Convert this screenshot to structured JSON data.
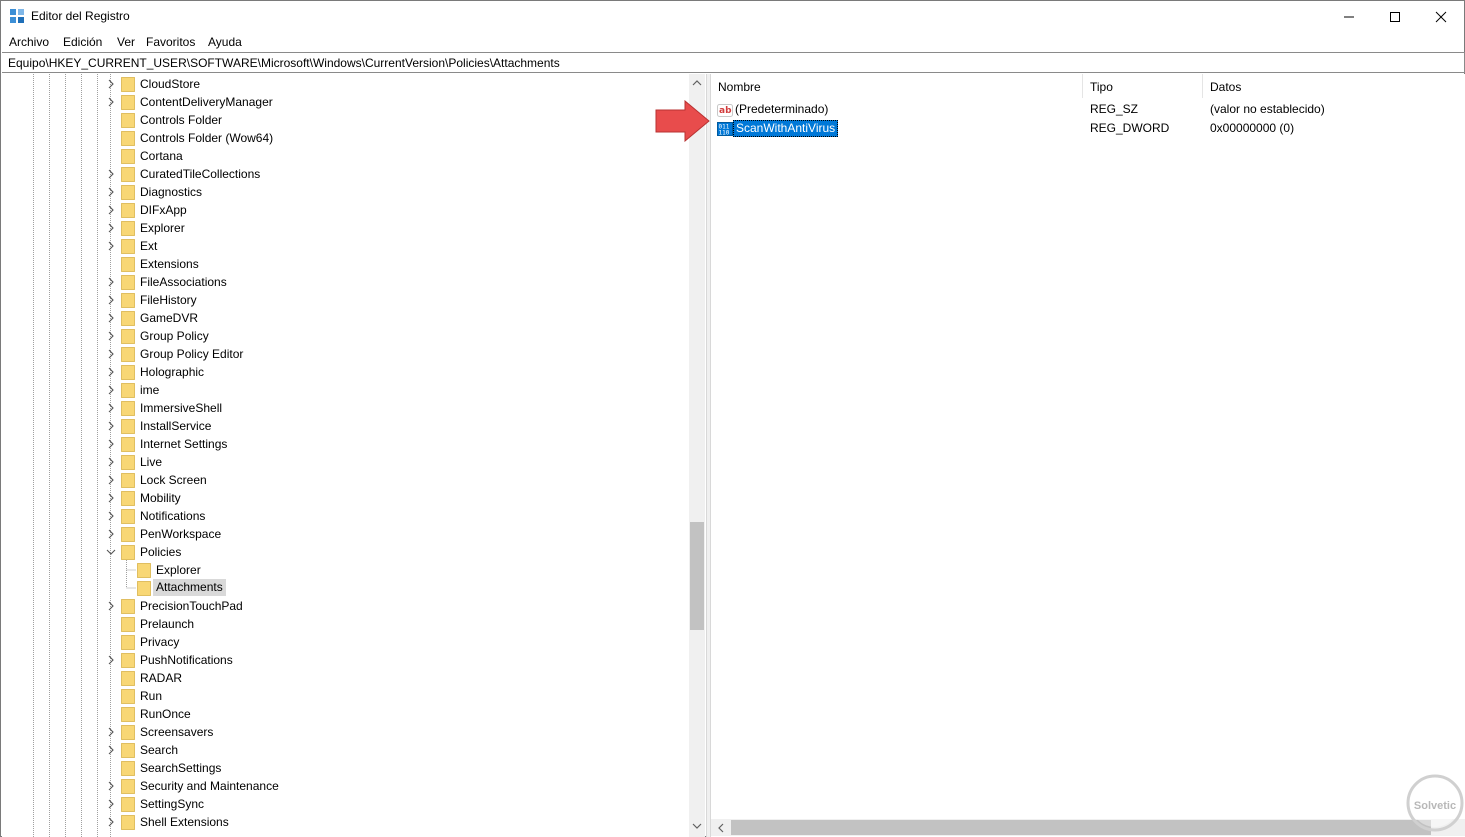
{
  "window": {
    "title": "Editor del Registro"
  },
  "menu": [
    "Archivo",
    "Edición",
    "Ver",
    "Favoritos",
    "Ayuda"
  ],
  "address": "Equipo\\HKEY_CURRENT_USER\\SOFTWARE\\Microsoft\\Windows\\CurrentVersion\\Policies\\Attachments",
  "tree": [
    {
      "label": "CloudStore",
      "expander": "collapsed",
      "level": 1
    },
    {
      "label": "ContentDeliveryManager",
      "expander": "collapsed",
      "level": 1
    },
    {
      "label": "Controls Folder",
      "expander": "none",
      "level": 1
    },
    {
      "label": "Controls Folder (Wow64)",
      "expander": "none",
      "level": 1
    },
    {
      "label": "Cortana",
      "expander": "none",
      "level": 1
    },
    {
      "label": "CuratedTileCollections",
      "expander": "collapsed",
      "level": 1
    },
    {
      "label": "Diagnostics",
      "expander": "collapsed",
      "level": 1
    },
    {
      "label": "DIFxApp",
      "expander": "collapsed",
      "level": 1
    },
    {
      "label": "Explorer",
      "expander": "collapsed",
      "level": 1
    },
    {
      "label": "Ext",
      "expander": "collapsed",
      "level": 1
    },
    {
      "label": "Extensions",
      "expander": "none",
      "level": 1
    },
    {
      "label": "FileAssociations",
      "expander": "collapsed",
      "level": 1
    },
    {
      "label": "FileHistory",
      "expander": "collapsed",
      "level": 1
    },
    {
      "label": "GameDVR",
      "expander": "collapsed",
      "level": 1
    },
    {
      "label": "Group Policy",
      "expander": "collapsed",
      "level": 1
    },
    {
      "label": "Group Policy Editor",
      "expander": "collapsed",
      "level": 1
    },
    {
      "label": "Holographic",
      "expander": "collapsed",
      "level": 1
    },
    {
      "label": "ime",
      "expander": "collapsed",
      "level": 1
    },
    {
      "label": "ImmersiveShell",
      "expander": "collapsed",
      "level": 1
    },
    {
      "label": "InstallService",
      "expander": "collapsed",
      "level": 1
    },
    {
      "label": "Internet Settings",
      "expander": "collapsed",
      "level": 1
    },
    {
      "label": "Live",
      "expander": "collapsed",
      "level": 1
    },
    {
      "label": "Lock Screen",
      "expander": "collapsed",
      "level": 1
    },
    {
      "label": "Mobility",
      "expander": "collapsed",
      "level": 1
    },
    {
      "label": "Notifications",
      "expander": "collapsed",
      "level": 1
    },
    {
      "label": "PenWorkspace",
      "expander": "collapsed",
      "level": 1
    },
    {
      "label": "Policies",
      "expander": "expanded",
      "level": 1
    },
    {
      "label": "Explorer",
      "expander": "none",
      "level": 2
    },
    {
      "label": "Attachments",
      "expander": "none",
      "level": 2,
      "selected": true
    },
    {
      "label": "PrecisionTouchPad",
      "expander": "collapsed",
      "level": 1
    },
    {
      "label": "Prelaunch",
      "expander": "none",
      "level": 1
    },
    {
      "label": "Privacy",
      "expander": "none",
      "level": 1
    },
    {
      "label": "PushNotifications",
      "expander": "collapsed",
      "level": 1
    },
    {
      "label": "RADAR",
      "expander": "none",
      "level": 1
    },
    {
      "label": "Run",
      "expander": "none",
      "level": 1
    },
    {
      "label": "RunOnce",
      "expander": "none",
      "level": 1
    },
    {
      "label": "Screensavers",
      "expander": "collapsed",
      "level": 1
    },
    {
      "label": "Search",
      "expander": "collapsed",
      "level": 1
    },
    {
      "label": "SearchSettings",
      "expander": "none",
      "level": 1
    },
    {
      "label": "Security and Maintenance",
      "expander": "collapsed",
      "level": 1
    },
    {
      "label": "SettingSync",
      "expander": "collapsed",
      "level": 1
    },
    {
      "label": "Shell Extensions",
      "expander": "collapsed",
      "level": 1
    }
  ],
  "list": {
    "columns": [
      "Nombre",
      "Tipo",
      "Datos"
    ],
    "rows": [
      {
        "name": "(Predeterminado)",
        "type": "REG_SZ",
        "data": "(valor no establecido)",
        "icon": "string-value-icon",
        "selected": false
      },
      {
        "name": "ScanWithAntiVirus",
        "type": "REG_DWORD",
        "data": "0x00000000 (0)",
        "icon": "dword-value-icon",
        "selected": true
      }
    ]
  },
  "colors": {
    "selection": "#0078d7",
    "folder": "#f8d775",
    "arrow": "#e84c4c",
    "tree_selected": "#d9d9d9"
  }
}
